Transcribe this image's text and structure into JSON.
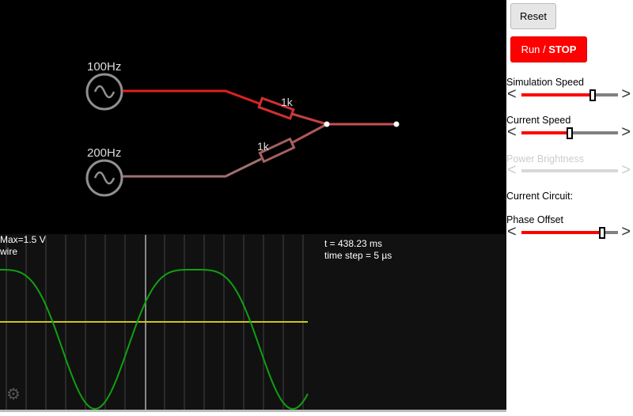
{
  "circuit": {
    "source1_label": "100Hz",
    "source2_label": "200Hz",
    "resistor1_label": "1k",
    "resistor2_label": "1k"
  },
  "scope": {
    "max_label": "Max=1.5 V",
    "element_label": "wire",
    "time": "t = 438.23 ms",
    "time_step": "time step = 5 µs",
    "settings_icon": "gear-icon"
  },
  "sidebar": {
    "reset": "Reset",
    "run": "Run / ",
    "stop": "STOP",
    "sim_speed": {
      "label": "Simulation Speed",
      "value": 0.74
    },
    "current_speed": {
      "label": "Current Speed",
      "value": 0.5
    },
    "power_brightness": {
      "label": "Power Brightness",
      "value": 0
    },
    "current_circuit": "Current Circuit:",
    "phase_offset": {
      "label": "Phase Offset",
      "value": 0.84
    },
    "left_arrow": "<",
    "right_arrow": ">"
  },
  "colors": {
    "wire_top": "#e02020",
    "wire_bottom": "#a07070",
    "wire_out": "#c85050",
    "trace": "#10a010",
    "zero_line": "#c8c820",
    "run_button": "#ff0000"
  }
}
